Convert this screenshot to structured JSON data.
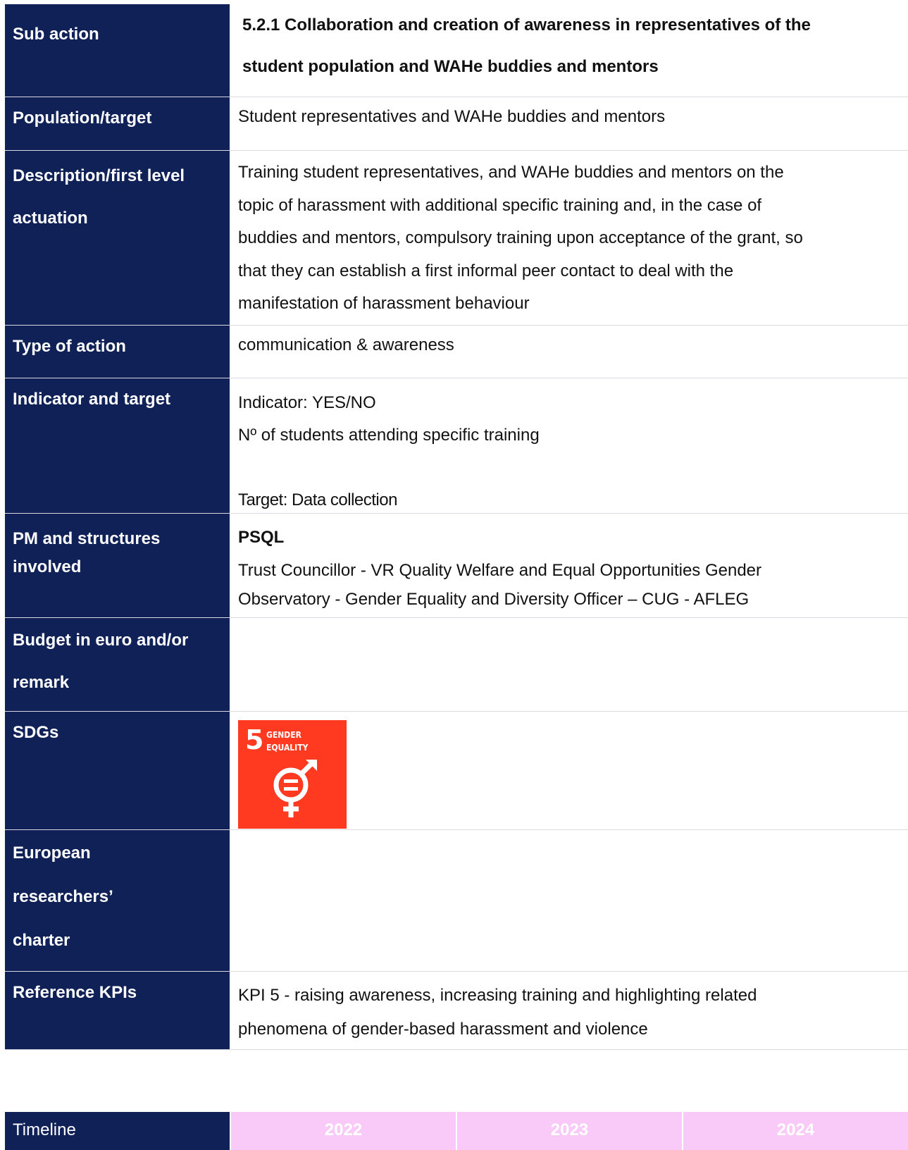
{
  "rows": {
    "sub_action": {
      "label": "Sub action",
      "line1": "5.2.1 Collaboration and creation of awareness in representatives of the",
      "line2": "student population and WAHe buddies and mentors"
    },
    "population": {
      "label": "Population/target",
      "value": "Student representatives and WAHe buddies and mentors"
    },
    "description": {
      "label_line1": "Description/first level",
      "label_line2": "actuation",
      "lines": [
        "Training student representatives, and WAHe buddies and mentors on the",
        "topic of harassment with additional specific training and, in the case of",
        "buddies and mentors, compulsory training upon acceptance of the grant, so",
        "that they can establish a first informal peer contact to deal with the",
        "manifestation of harassment behaviour"
      ]
    },
    "type_of_action": {
      "label": "Type of action",
      "value": "communication & awareness"
    },
    "indicator": {
      "label": "Indicator and target",
      "indicator": "Indicator: YES/NO",
      "students": "Nº of students attending specific training",
      "target": "Target: Data collection"
    },
    "pm": {
      "label_line1": "PM and structures",
      "label_line2": "involved",
      "head": "PSQL",
      "line1": "Trust Councillor - VR Quality Welfare and Equal Opportunities Gender",
      "line2": "Observatory - Gender Equality and Diversity Officer – CUG - AFLEG"
    },
    "budget": {
      "label_line1": "Budget in euro and/or",
      "label_line2": "remark",
      "value": ""
    },
    "sdgs": {
      "label": "SDGs",
      "badge_number": "5",
      "badge_line1": "GENDER",
      "badge_line2": "EQUALITY",
      "badge_color": "#ff3a21",
      "badge_icon": "gender-equality-icon"
    },
    "charter": {
      "label_line1": "European",
      "label_line2": "researchers’",
      "label_line3": "charter",
      "value": ""
    },
    "kpi": {
      "label": "Reference KPIs",
      "line1": "KPI 5 - raising awareness, increasing training and highlighting related",
      "line2": "phenomena of gender-based harassment and violence"
    }
  },
  "timeline": {
    "label": "Timeline",
    "years": [
      "2022",
      "2023",
      "2024"
    ]
  },
  "colors": {
    "label_bg": "#0f2157",
    "timeline_year_bg": "#f9c9f8"
  }
}
